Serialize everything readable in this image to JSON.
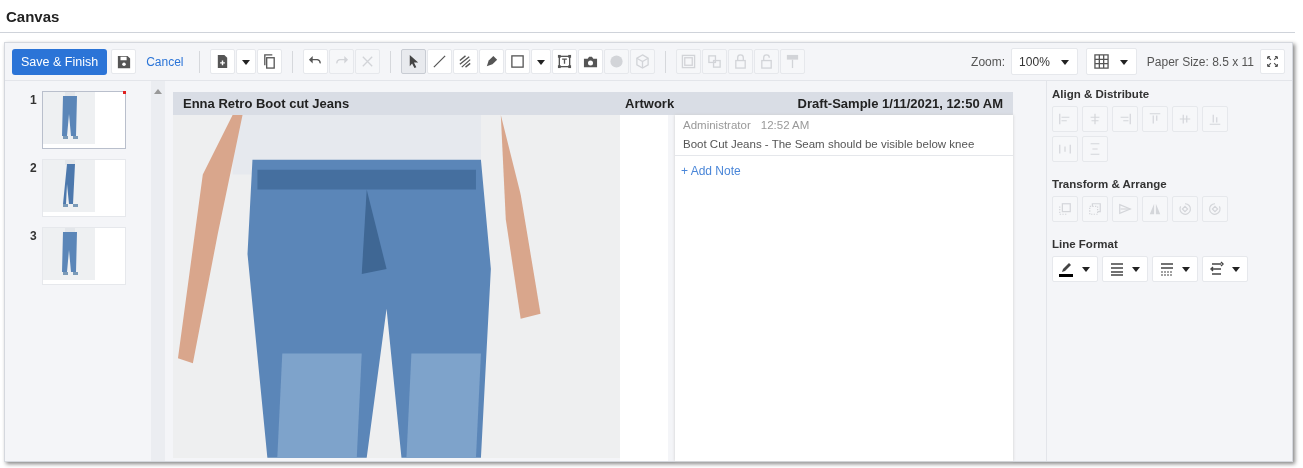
{
  "page_title": "Canvas",
  "toolbar": {
    "save_button": "Save & Finish",
    "save_icon": {
      "disabled": false
    },
    "cancel_link": "Cancel",
    "tool_groups": [
      [
        {
          "kind": "split",
          "disabled": false
        },
        {
          "kind": "tool",
          "disabled": false
        }
      ],
      [
        {
          "kind": "tool",
          "disabled": false
        },
        {
          "kind": "tool",
          "disabled": true
        },
        {
          "kind": "tool",
          "disabled": true
        }
      ],
      [
        {
          "kind": "tool",
          "disabled": false,
          "selected": true
        },
        {
          "kind": "tool",
          "disabled": false,
          "selected": false
        },
        {
          "kind": "tool",
          "disabled": false,
          "selected": false
        },
        {
          "kind": "tool",
          "disabled": false,
          "selected": false
        },
        {
          "kind": "split",
          "disabled": false,
          "selected": false
        },
        {
          "kind": "tool",
          "disabled": false,
          "selected": false
        },
        {
          "kind": "tool",
          "disabled": false,
          "selected": false
        },
        {
          "kind": "tool",
          "disabled": true,
          "selected": false
        },
        {
          "kind": "tool",
          "disabled": true,
          "selected": false
        }
      ],
      [
        {
          "kind": "tool",
          "disabled": true
        },
        {
          "kind": "tool",
          "disabled": true
        },
        {
          "kind": "tool",
          "disabled": true
        },
        {
          "kind": "tool",
          "disabled": true
        },
        {
          "kind": "tool",
          "disabled": true
        }
      ]
    ],
    "zoom_label": "Zoom:",
    "zoom_value": "100%",
    "paper_size": "Paper Size: 8.5 x 11"
  },
  "pages": [
    {
      "number": "1",
      "selected": true,
      "flagged": true
    },
    {
      "number": "2",
      "selected": false,
      "flagged": false
    },
    {
      "number": "3",
      "selected": false,
      "flagged": false
    }
  ],
  "canvas": {
    "product": "Enna Retro Boot cut Jeans",
    "section": "Artwork",
    "status": "Draft-Sample 1/11/2021, 12:50 AM",
    "notes": [
      {
        "author": "Administrator",
        "time": "12:52 AM",
        "text": "Boot Cut Jeans - The Seam should be visible below knee"
      }
    ],
    "add_note": "+ Add Note"
  },
  "panel": [
    {
      "title": "Align & Distribute",
      "controls": [
        {
          "disabled": true
        },
        {
          "disabled": true
        },
        {
          "disabled": true
        },
        {
          "disabled": true
        },
        {
          "disabled": true
        },
        {
          "disabled": true
        },
        {
          "disabled": true
        },
        {
          "disabled": true
        }
      ]
    },
    {
      "title": "Transform & Arrange",
      "controls": [
        {
          "disabled": true
        },
        {
          "disabled": true
        },
        {
          "disabled": true
        },
        {
          "disabled": true
        },
        {
          "disabled": true
        },
        {
          "disabled": true
        }
      ]
    },
    {
      "title": "Line Format",
      "controls": [
        {
          "disabled": false
        },
        {
          "disabled": false
        },
        {
          "disabled": false
        },
        {
          "disabled": false
        }
      ]
    }
  ]
}
